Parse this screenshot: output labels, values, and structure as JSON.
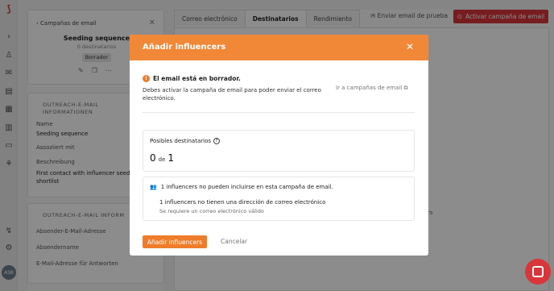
{
  "sidebar": {
    "back_label": "Campañas de email",
    "sequence_title": "Seeding sequence",
    "recipients_count": "0 destinatarios",
    "status_badge": "Borrador",
    "section1_title": "OUTREACH-E-MAIL INFORMATIONEN",
    "fields": [
      {
        "label": "Name",
        "value": "Seeding sequence"
      },
      {
        "label": "Assoziiert mit",
        "value": ""
      },
      {
        "label": "Beschreibung",
        "value": "First contact with influencer seeding shortlist"
      }
    ],
    "section2_title": "OUTREACH-E-MAIL INFORM",
    "fields2": [
      {
        "label": "Absender-E-Mail-Adresse"
      },
      {
        "label": "Absendername"
      },
      {
        "label": "E-Mail-Adresse für Antworten"
      }
    ]
  },
  "main": {
    "tabs": [
      "Correo electrónico",
      "Destinatarios",
      "Rendimiento"
    ],
    "active_tab": "Destinatarios",
    "test_email_label": "Enviar email de prueba",
    "activate_label": "Activar campaña de email",
    "background_text": "rs"
  },
  "rail": {
    "avatar_initials": "ASB"
  },
  "modal": {
    "title": "Añadir influencers",
    "warning_title": "El email está en borrador.",
    "warning_body": "Debes activar la campaña de email para poder enviar el correo electrónico.",
    "goto_link": "Ir a campañas de email",
    "possible_label": "Posibles destinatarios",
    "count_value": "0",
    "count_of": "de",
    "count_total": "1",
    "excluded_summary": "1 influencers no pueden incluirse en esta campaña de email.",
    "excluded_reason": "1 influencers no tienen una dirección de correo electrónico",
    "excluded_hint": "Se requiere un correo electrónico válido",
    "add_button": "Añadir influencers",
    "cancel_button": "Cancelar"
  },
  "colors": {
    "brand_red": "#d9353b",
    "modal_orange": "#f08838"
  }
}
